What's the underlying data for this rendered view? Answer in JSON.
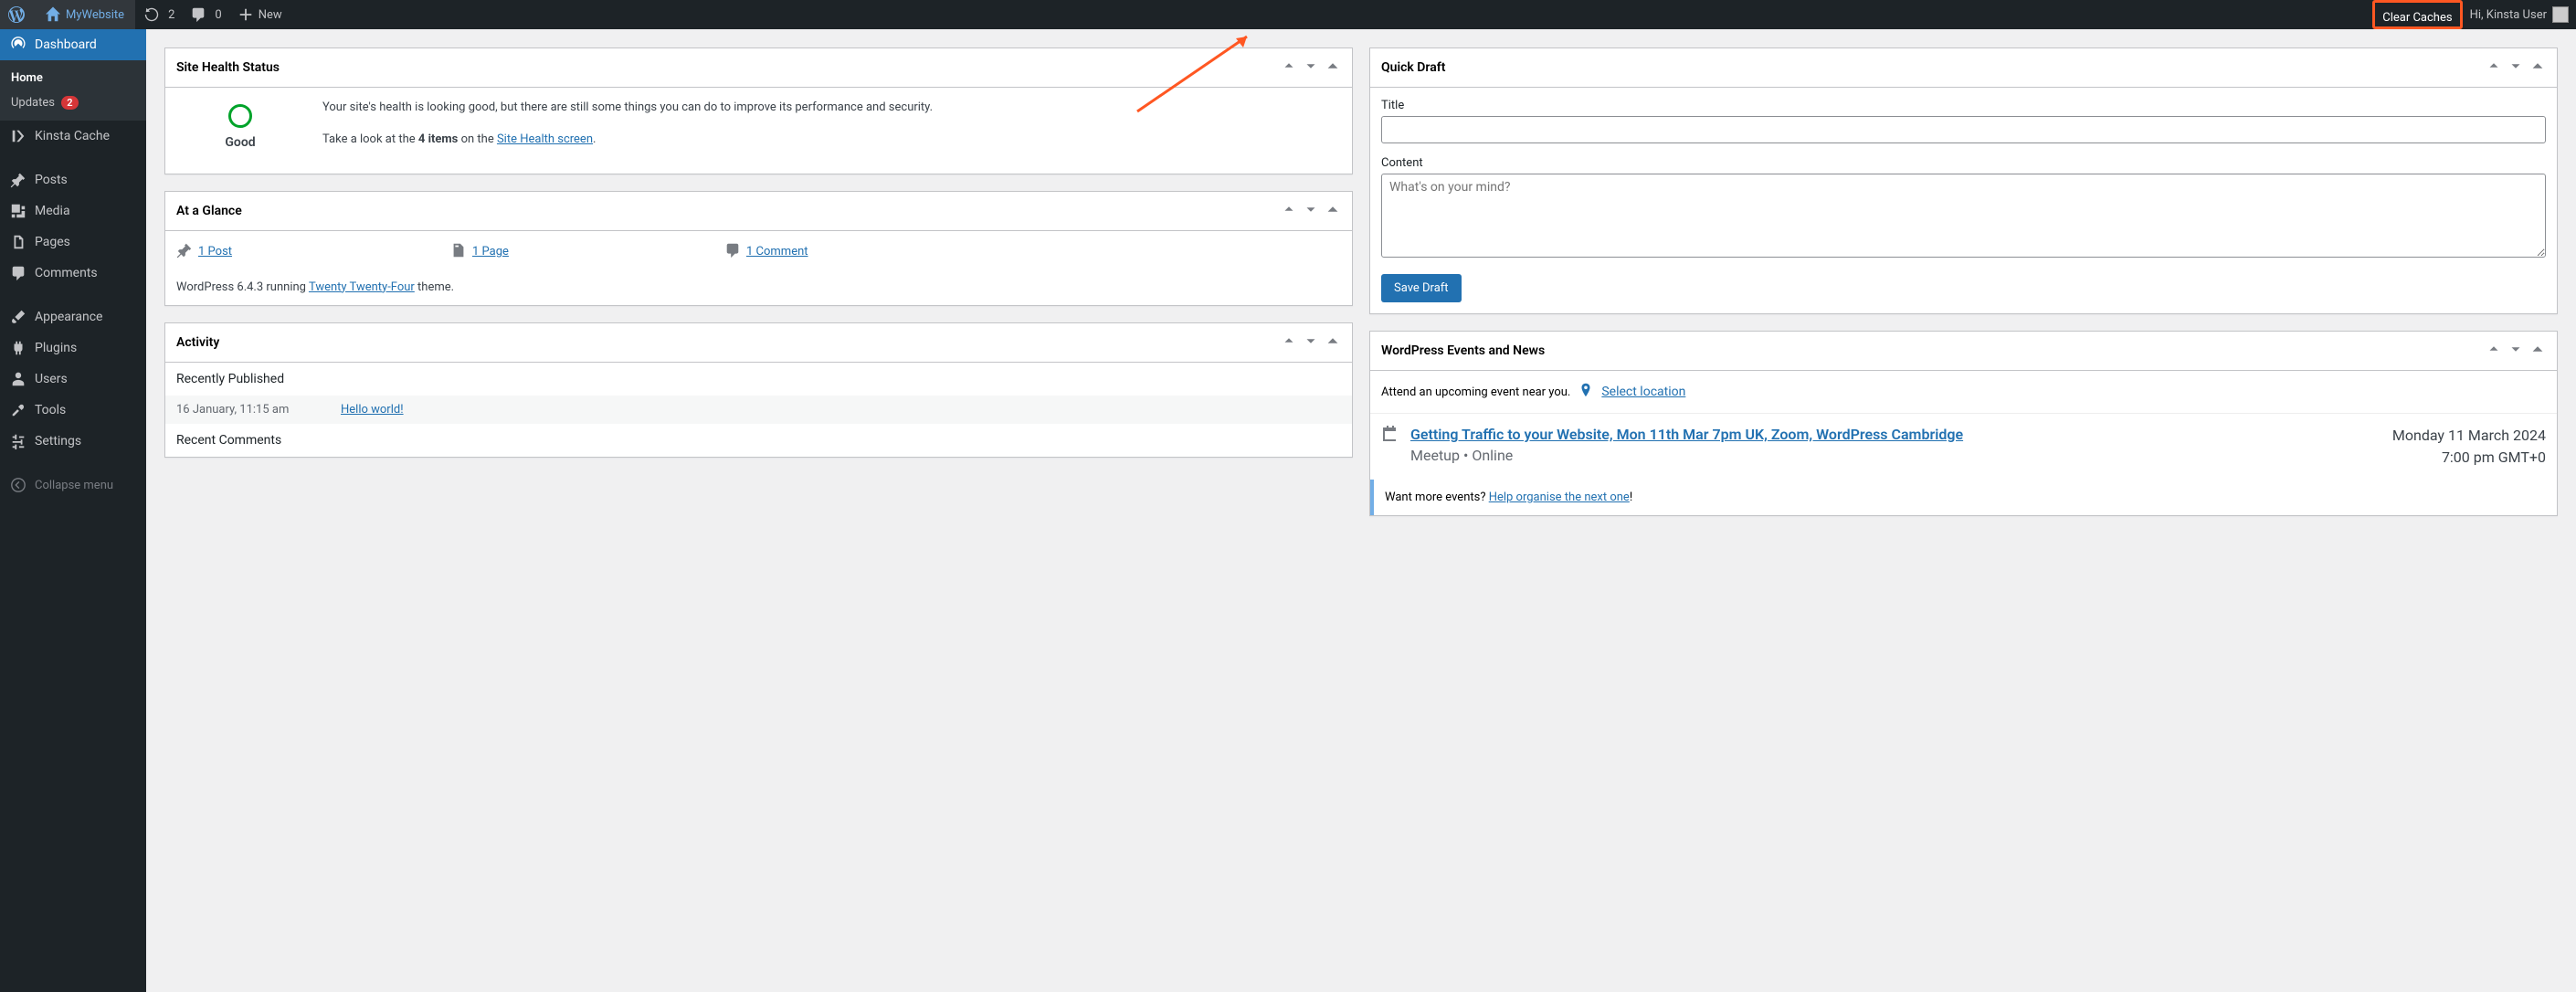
{
  "adminbar": {
    "site_name": "MyWebsite",
    "updates": "2",
    "comments": "0",
    "new": "New",
    "clear_caches": "Clear Caches",
    "greeting": "Hi, Kinsta User"
  },
  "sidebar": {
    "dashboard": "Dashboard",
    "home": "Home",
    "updates": "Updates",
    "updates_count": "2",
    "kinsta": "Kinsta Cache",
    "posts": "Posts",
    "media": "Media",
    "pages": "Pages",
    "comments": "Comments",
    "appearance": "Appearance",
    "plugins": "Plugins",
    "users": "Users",
    "tools": "Tools",
    "settings": "Settings",
    "collapse": "Collapse menu"
  },
  "site_health": {
    "title": "Site Health Status",
    "status": "Good",
    "text1": "Your site's health is looking good, but there are still some things you can do to improve its performance and security.",
    "text2a": "Take a look at the ",
    "text2b": "4 items",
    "text2c": " on the ",
    "link": "Site Health screen",
    "text2d": "."
  },
  "glance": {
    "title": "At a Glance",
    "posts": "1 Post",
    "pages": "1 Page",
    "comments": "1 Comment",
    "version_a": "WordPress 6.4.3 running ",
    "theme": "Twenty Twenty-Four",
    "version_b": " theme."
  },
  "activity": {
    "title": "Activity",
    "recently_published": "Recently Published",
    "pub_date": "16 January, 11:15 am",
    "pub_title": "Hello world!",
    "recent_comments": "Recent Comments"
  },
  "quick_draft": {
    "title": "Quick Draft",
    "title_label": "Title",
    "content_label": "Content",
    "content_placeholder": "What's on your mind?",
    "save": "Save Draft"
  },
  "events": {
    "title": "WordPress Events and News",
    "attend": "Attend an upcoming event near you.",
    "select_location": "Select location",
    "event_title": "Getting Traffic to your Website, Mon 11th Mar 7pm UK, Zoom, WordPress Cambridge",
    "event_meta": "Meetup • Online",
    "event_date": "Monday 11 March 2024",
    "event_time": "7:00 pm GMT+0",
    "more_a": "Want more events? ",
    "more_link": "Help organise the next one",
    "more_b": "!"
  }
}
